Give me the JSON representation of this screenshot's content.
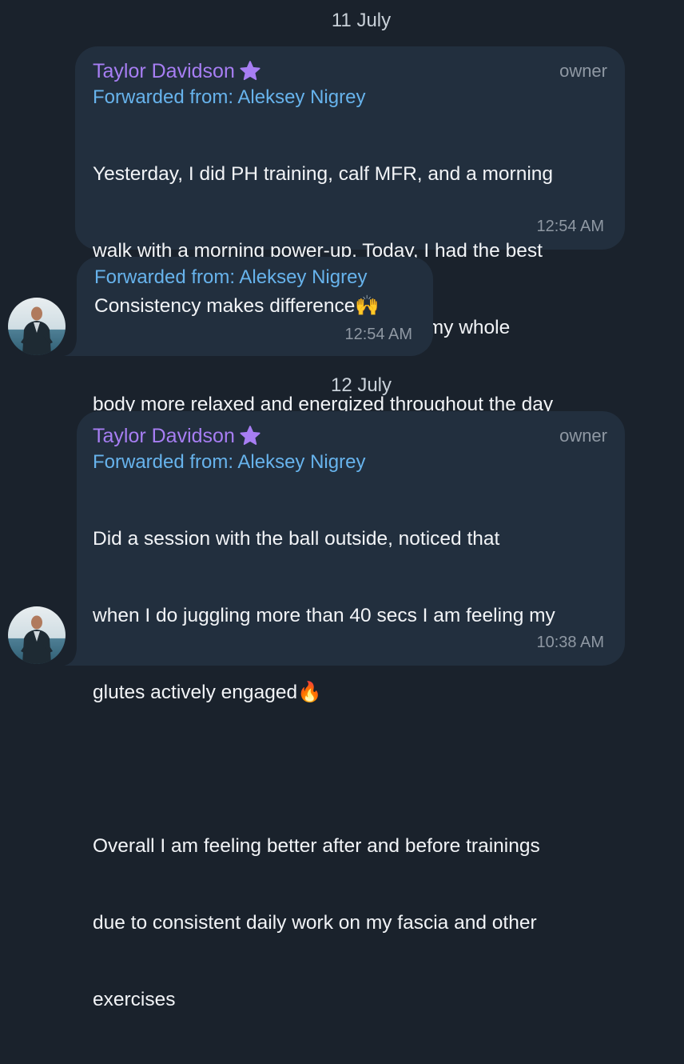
{
  "dates": [
    "11 July",
    "12 July"
  ],
  "messages": [
    {
      "sender": "Taylor Davidson",
      "role": "owner",
      "forwarded": "Forwarded from: Aleksey Nigrey",
      "lines": [
        "Yesterday, I did PH training, calf MFR, and a morning",
        "walk with a morning power-up. Today, I had the best",
        "sleep I've had in the past year and felt my whole",
        "body more relaxed and energized throughout the day",
        "🔥"
      ],
      "time": "12:54 AM"
    },
    {
      "forwarded": "Forwarded from: Aleksey Nigrey",
      "text": "Consistency makes difference🙌",
      "time": "12:54 AM"
    },
    {
      "sender": "Taylor Davidson",
      "role": "owner",
      "forwarded": "Forwarded from: Aleksey Nigrey",
      "lines": [
        "Did a session with the ball outside, noticed that",
        "when I do juggling more than 40 secs I am feeling my",
        "glutes actively engaged🔥",
        "",
        "Overall I am feeling better after and before trainings",
        "due to consistent daily work on my fascia and other",
        "exercises"
      ],
      "time": "10:38 AM"
    }
  ],
  "colors": {
    "background": "#1a222c",
    "bubble": "#222f3e",
    "sender": "#a77ef3",
    "forwarded": "#67b3ec",
    "meta": "#8f98a3"
  },
  "icons": [
    "star-icon",
    "avatar"
  ]
}
